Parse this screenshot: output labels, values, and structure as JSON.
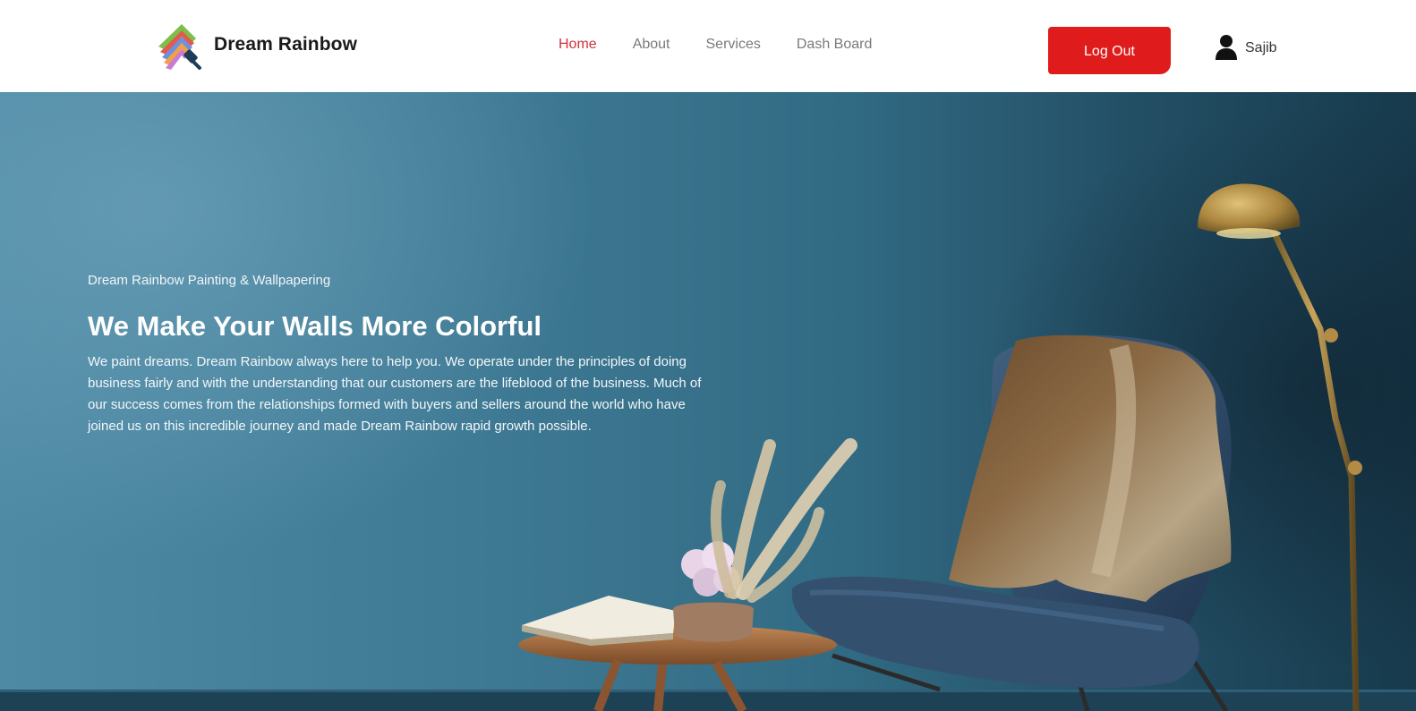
{
  "brand": {
    "name": "Dream Rainbow",
    "logo_icon": "rainbow-paint-roller-icon"
  },
  "nav": {
    "links": [
      {
        "label": "Home",
        "active": true
      },
      {
        "label": "About",
        "active": false
      },
      {
        "label": "Services",
        "active": false
      },
      {
        "label": "Dash Board",
        "active": false
      }
    ],
    "active_color": "#d0333a"
  },
  "auth": {
    "logout_label": "Log Out",
    "button_color": "#df1b1b"
  },
  "user": {
    "name": "Sajib",
    "icon": "user-icon"
  },
  "hero": {
    "kicker": "Dream Rainbow Painting & Wallpapering",
    "title": "We Make Your Walls More Colorful",
    "text": "We paint dreams. Dream Rainbow always here to help you. We operate under the principles of doing business fairly and with the understanding that our customers are the lifeblood of the business. Much of our success comes from the relationships formed with buyers and sellers around the world who have joined us on this incredible journey and made Dream Rainbow rapid growth possible."
  }
}
